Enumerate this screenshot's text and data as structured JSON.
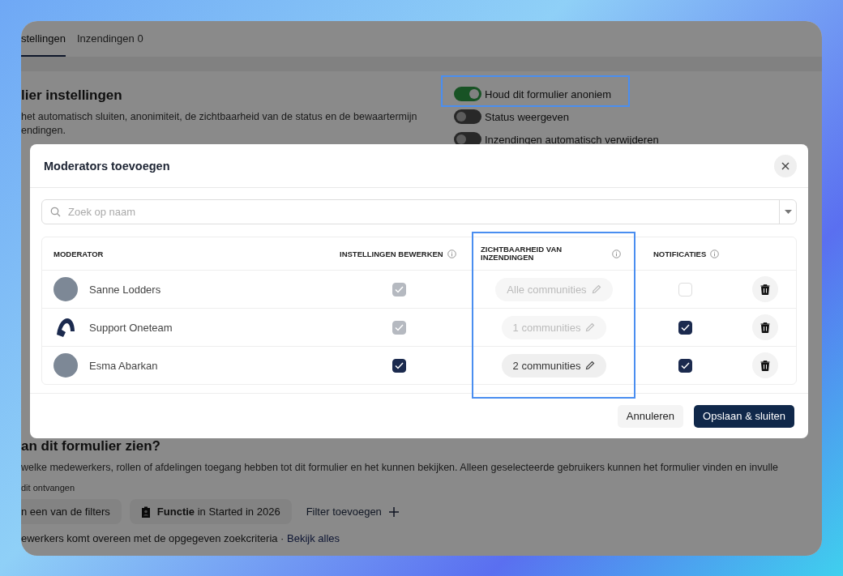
{
  "tabs": [
    {
      "label": "stellingen",
      "selected": true
    },
    {
      "label": "Inzendingen 0",
      "selected": false
    }
  ],
  "settings": {
    "title": "lier instellingen",
    "description": "het automatisch sluiten, anonimiteit, de zichtbaarheid van de status en de bewaartermijn\nendingen.",
    "toggles": [
      {
        "label": "Houd dit formulier anoniem",
        "on": true
      },
      {
        "label": "Status weergeven",
        "on": false
      },
      {
        "label": "Inzendingen automatisch verwijderen",
        "on": false
      }
    ]
  },
  "access": {
    "title": "an dit formulier zien?",
    "description": "welke medewerkers, rollen of afdelingen toegang hebben tot dit formulier en het kunnen bekijken. Alleen geselecteerde gebruikers kunnen het formulier vinden en invulle",
    "label": "dit ontvangen",
    "filters": [
      {
        "kind": "text",
        "label": "n een van de filters"
      },
      {
        "kind": "chip",
        "label": "**Functie** in Started in 2026"
      },
      {
        "kind": "add",
        "label": "Filter toevoegen"
      }
    ],
    "result": "ewerkers komt overeen met de opgegeven zoekcriteria · ",
    "result_link": "Bekijk alles"
  },
  "modal": {
    "title": "Moderators toevoegen",
    "search": {
      "placeholder": "Zoek op naam"
    },
    "columns": [
      "MODERATOR",
      "INSTELLINGEN BEWERKEN",
      "ZICHTBAARHEID VAN INZENDINGEN",
      "NOTIFICATIES"
    ],
    "rows": [
      {
        "name": "Sanne Lodders",
        "kind": "photo",
        "edit_settings": {
          "checked": true,
          "disabled": true
        },
        "visibility": {
          "label": "Alle communities",
          "disabled": true
        },
        "notifications": {
          "checked": false
        }
      },
      {
        "name": "Support Oneteam",
        "kind": "logo",
        "edit_settings": {
          "checked": true,
          "disabled": true
        },
        "visibility": {
          "label": "1 communities",
          "disabled": true
        },
        "notifications": {
          "checked": true
        }
      },
      {
        "name": "Esma Abarkan",
        "kind": "photo",
        "edit_settings": {
          "checked": true,
          "disabled": false
        },
        "visibility": {
          "label": "2 communities",
          "disabled": false
        },
        "notifications": {
          "checked": true
        }
      }
    ],
    "buttons": [
      {
        "kind": "secondary",
        "label": "Annuleren"
      },
      {
        "kind": "primary",
        "label": "Opslaan & sluiten"
      }
    ]
  }
}
